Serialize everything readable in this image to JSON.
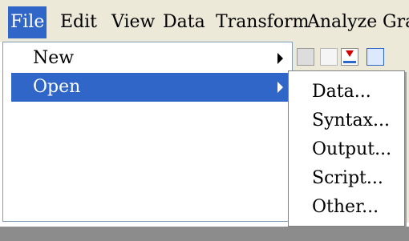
{
  "menubar": {
    "items": [
      {
        "label": "File",
        "active": true
      },
      {
        "label": "Edit"
      },
      {
        "label": "View"
      },
      {
        "label": "Data"
      },
      {
        "label": "Transform"
      },
      {
        "label": "Analyze"
      },
      {
        "label": "Gra"
      }
    ]
  },
  "file_menu": {
    "items": [
      {
        "label": "New",
        "has_submenu": true
      },
      {
        "label": "Open",
        "has_submenu": true,
        "active": true
      }
    ]
  },
  "open_submenu": {
    "items": [
      {
        "label": "Data..."
      },
      {
        "label": "Syntax..."
      },
      {
        "label": "Output..."
      },
      {
        "label": "Script..."
      },
      {
        "label": "Other..."
      }
    ]
  },
  "colors": {
    "highlight": "#3166c9",
    "menubar_bg": "#ece9d8",
    "status_band": "#8c8c8c"
  },
  "toolbar_icons": [
    "binoculars-icon",
    "variable-icon",
    "chart-builder-icon",
    "grid-icon"
  ]
}
